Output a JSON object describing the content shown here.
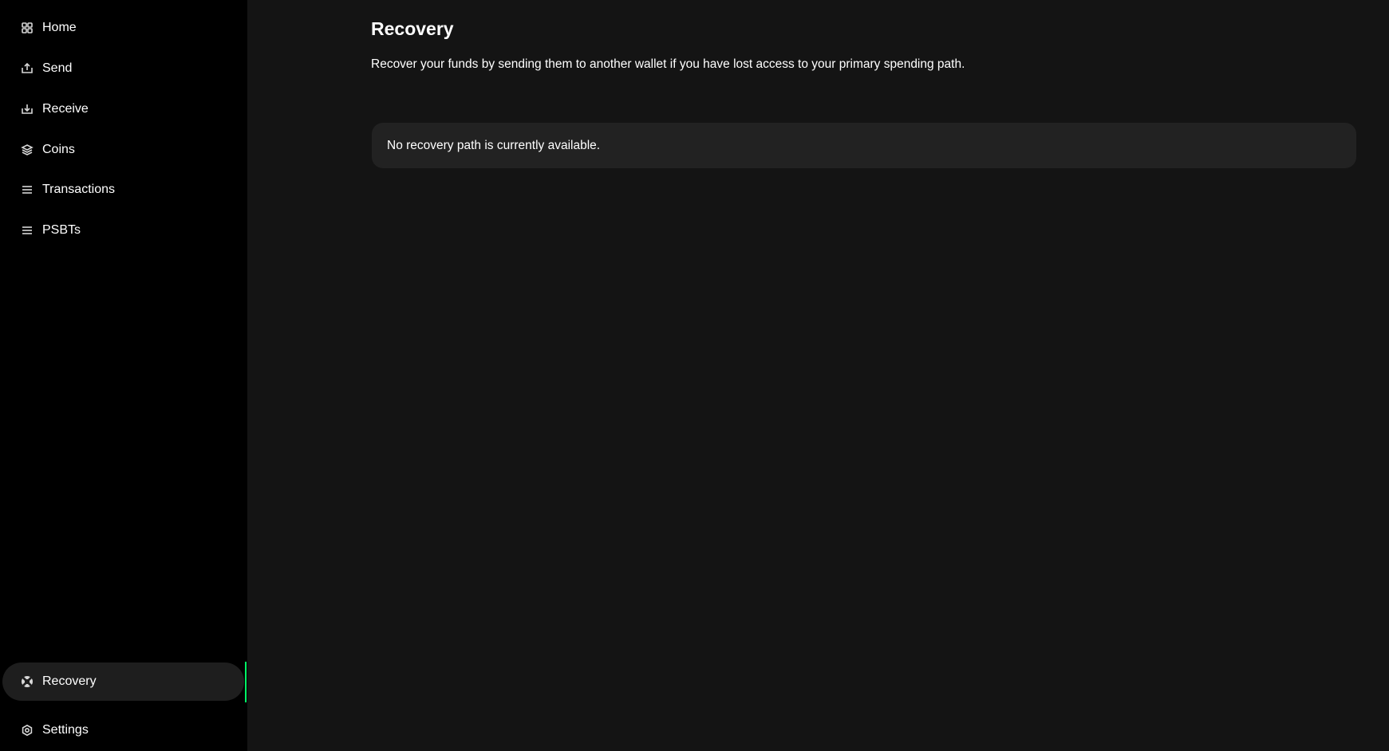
{
  "sidebar": {
    "items": [
      {
        "label": "Home",
        "icon": "grid-icon"
      },
      {
        "label": "Send",
        "icon": "send-icon"
      },
      {
        "label": "Receive",
        "icon": "receive-icon"
      },
      {
        "label": "Coins",
        "icon": "layers-icon"
      },
      {
        "label": "Transactions",
        "icon": "list-icon"
      },
      {
        "label": "PSBTs",
        "icon": "list-icon"
      }
    ],
    "recovery": {
      "label": "Recovery",
      "icon": "lifebuoy-icon"
    },
    "settings": {
      "label": "Settings",
      "icon": "gear-icon"
    }
  },
  "main": {
    "title": "Recovery",
    "description": "Recover your funds by sending them to another wallet if you have lost access to your primary spending path.",
    "card_message": "No recovery path is currently available."
  },
  "colors": {
    "accent": "#00ff66",
    "sidebar_bg": "#000000",
    "main_bg": "#141414",
    "card_bg": "#222222"
  }
}
